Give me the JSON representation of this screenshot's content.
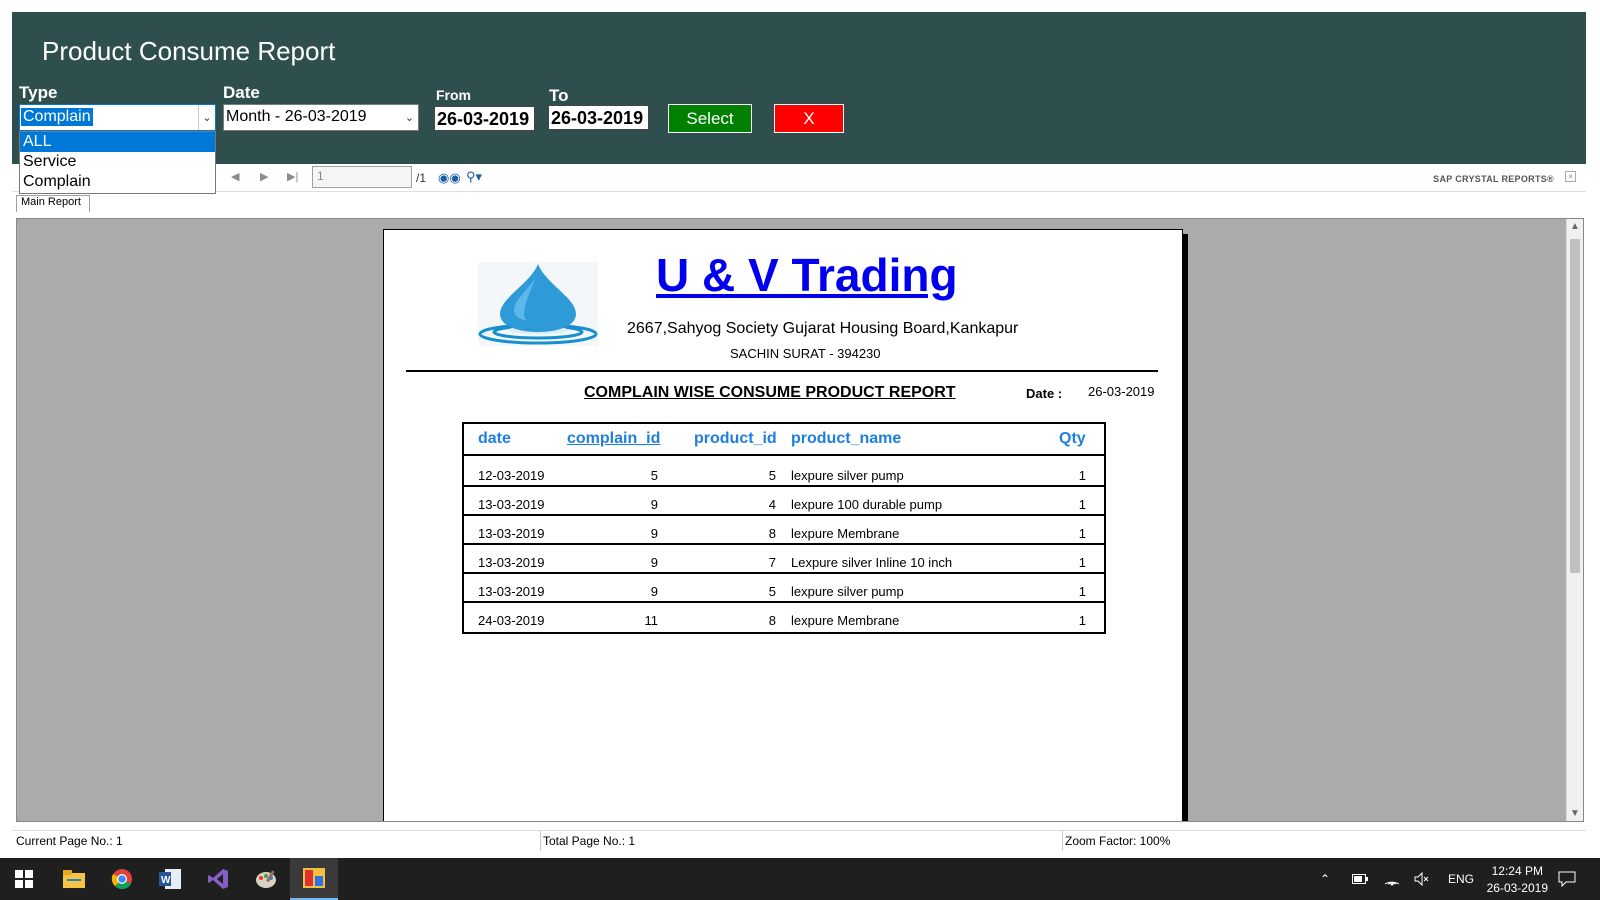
{
  "window": {
    "title": "Product Consume Report"
  },
  "filters": {
    "type_label": "Type",
    "type_value": "Complain",
    "type_options": [
      "ALL",
      "Service",
      "Complain"
    ],
    "date_label": "Date",
    "date_value": "Month - 26-03-2019",
    "from_label": "From",
    "from_value": "26-03-2019",
    "to_label": "To",
    "to_value": "26-03-2019",
    "select_label": "Select",
    "close_label": "X"
  },
  "viewer": {
    "page_input": "1",
    "page_total": "/1",
    "brand": "SAP CRYSTAL REPORTS®",
    "tab": "Main Report"
  },
  "report": {
    "company": "U & V Trading",
    "address1": "2667,Sahyog Society Gujarat Housing Board,Kankapur",
    "address2": "SACHIN SURAT - 394230",
    "title": "COMPLAIN WISE CONSUME PRODUCT REPORT",
    "date_label": "Date :",
    "date_value": "26-03-2019",
    "columns": [
      "date",
      "complain_id",
      "product_id",
      "product_name",
      "Qty"
    ],
    "rows": [
      [
        "12-03-2019",
        "5",
        "5",
        "lexpure silver pump",
        "1"
      ],
      [
        "13-03-2019",
        "9",
        "4",
        "lexpure 100  durable pump",
        "1"
      ],
      [
        "13-03-2019",
        "9",
        "8",
        "lexpure Membrane",
        "1"
      ],
      [
        "13-03-2019",
        "9",
        "7",
        "Lexpure silver Inline 10 inch",
        "1"
      ],
      [
        "13-03-2019",
        "9",
        "5",
        "lexpure silver pump",
        "1"
      ],
      [
        "24-03-2019",
        "11",
        "8",
        "lexpure Membrane",
        "1"
      ]
    ]
  },
  "status": {
    "current_page": "Current Page No.: 1",
    "total_page": "Total Page No.: 1",
    "zoom": "Zoom Factor: 100%"
  },
  "taskbar": {
    "lang": "ENG",
    "time": "12:24 PM",
    "date": "26-03-2019"
  },
  "colors": {
    "header_bg": "#2f4f4f",
    "select_btn": "#008000",
    "close_btn": "#ff0000",
    "column_header": "#1e7fe0",
    "company_link": "#0000ee"
  }
}
